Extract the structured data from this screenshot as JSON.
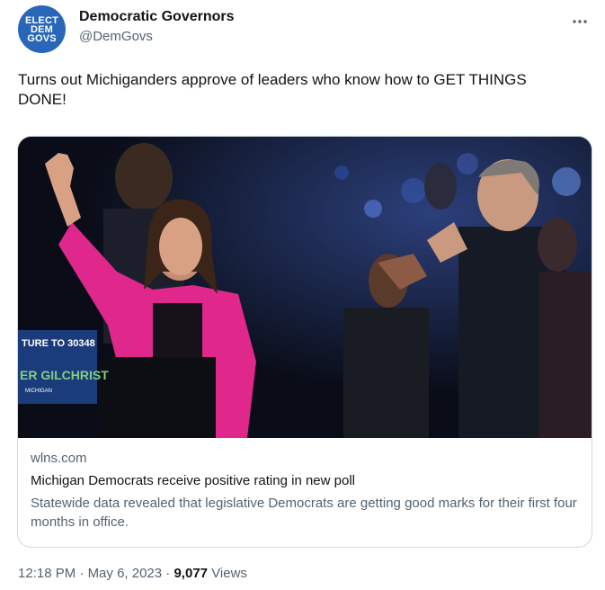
{
  "author": {
    "display_name": "Democratic Governors",
    "handle": "@DemGovs",
    "avatar_text": [
      "ELECT",
      "DEM",
      "GOVS"
    ]
  },
  "tweet": {
    "text": "Turns out Michiganders approve of leaders who know how to GET THINGS DONE!"
  },
  "card": {
    "photo_sign": {
      "line1": "TURE TO 30348",
      "line2": "ER GILCHRIST",
      "line3": "MICHIGAN"
    },
    "domain": "wlns.com",
    "title": "Michigan Democrats receive positive rating in new poll",
    "description": "Statewide data revealed that legislative Democrats are getting good marks for their first four months in office."
  },
  "meta": {
    "time": "12:18 PM",
    "date": "May 6, 2023",
    "views_count": "9,077",
    "views_label": "Views"
  },
  "colors": {
    "accent_pink": "#e0288c",
    "avatar_blue": "#2a66b8",
    "secondary_text": "#536471"
  }
}
